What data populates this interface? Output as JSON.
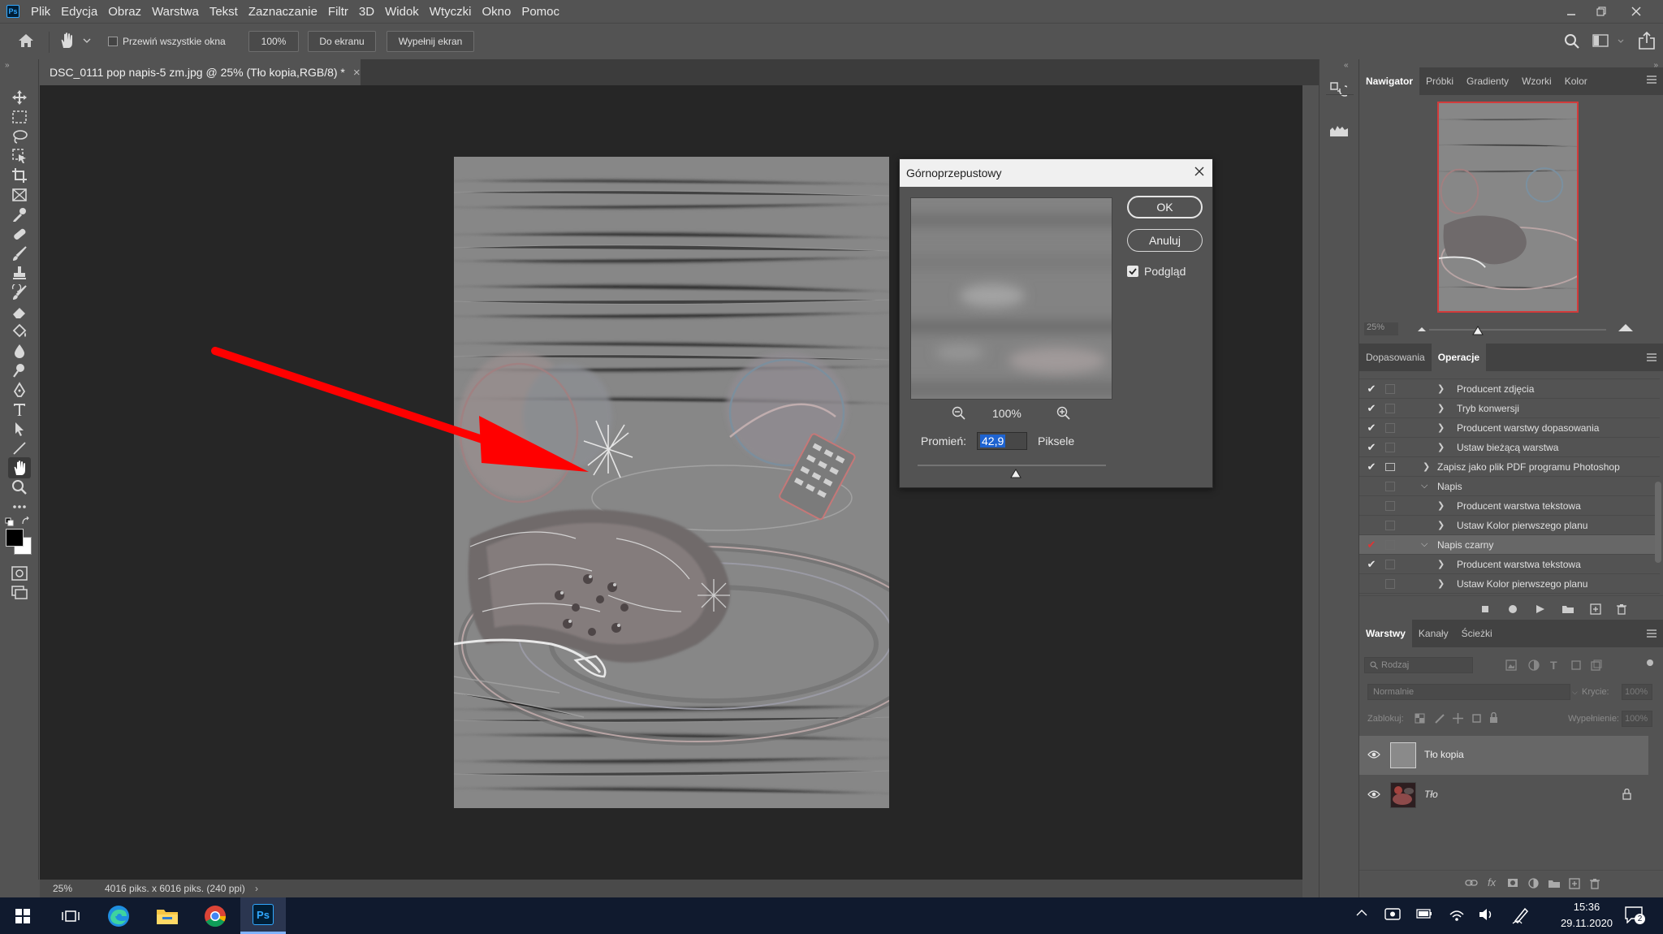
{
  "app": {
    "logo": "Ps"
  },
  "menu": [
    "Plik",
    "Edycja",
    "Obraz",
    "Warstwa",
    "Tekst",
    "Zaznaczanie",
    "Filtr",
    "3D",
    "Widok",
    "Wtyczki",
    "Okno",
    "Pomoc"
  ],
  "options_bar": {
    "scroll_all_label": "Przewiń wszystkie okna",
    "zoom_button": "100%",
    "fit_screen_button": "Do ekranu",
    "fill_screen_button": "Wypełnij ekran"
  },
  "document": {
    "tab_title": "DSC_0111 pop napis-5 zm.jpg @ 25% (Tło kopia,RGB/8) *",
    "close_glyph": "×"
  },
  "status": {
    "zoom": "25%",
    "info": "4016 piks. x 6016 piks. (240 ppi)"
  },
  "dialog": {
    "title": "Górnoprzepustowy",
    "ok": "OK",
    "cancel": "Anuluj",
    "preview_label": "Podgląd",
    "preview_checked": true,
    "zoom": "100%",
    "radius_label": "Promień:",
    "radius_value": "42,9",
    "unit": "Piksele",
    "radius_slider_fraction": 0.52
  },
  "panels": {
    "top_tabs": [
      "Nawigator",
      "Próbki",
      "Gradienty",
      "Wzorki",
      "Kolor"
    ],
    "navigator_zoom": "25%",
    "mid_tabs": [
      "Dopasowania",
      "Operacje"
    ],
    "actions": [
      {
        "check": "✔",
        "label": "Producent zdjęcia",
        "level": 2
      },
      {
        "check": "✔",
        "label": "Tryb konwersji",
        "level": 2
      },
      {
        "check": "✔",
        "label": "Producent warstwy dopasowania",
        "level": 2
      },
      {
        "check": "✔",
        "label": "Ustaw bieżącą warstwa",
        "level": 2
      },
      {
        "check": "✔",
        "label": "Zapisz jako plik PDF programu Photoshop",
        "level": 1
      },
      {
        "check": "",
        "label": "Napis",
        "level": 1
      },
      {
        "check": "",
        "label": "Producent warstwa tekstowa",
        "level": 2
      },
      {
        "check": "",
        "label": "Ustaw Kolor pierwszego planu",
        "level": 2
      },
      {
        "check": "✔",
        "label": "Napis czarny",
        "level": 1
      },
      {
        "check": "✔",
        "label": "Producent warstwa tekstowa",
        "level": 2
      },
      {
        "check": "",
        "label": "Ustaw Kolor pierwszego planu",
        "level": 2
      }
    ],
    "layers_tabs": [
      "Warstwy",
      "Kanały",
      "Ścieżki"
    ],
    "filter_placeholder": "Rodzaj",
    "blend_mode": "Normalnie",
    "opacity_label": "Krycie:",
    "opacity_value": "100%",
    "lock_label": "Zablokuj:",
    "fill_label": "Wypełnienie:",
    "fill_value": "100%",
    "layers": [
      {
        "name": "Tło kopia",
        "selected": true
      },
      {
        "name": "Tło",
        "selected": false
      }
    ]
  },
  "taskbar": {
    "time": "15:36",
    "date": "29.11.2020",
    "notifications": "2"
  },
  "colors": {
    "accent_red": "#ff0000",
    "selection_blue": "#1e63d0",
    "panel_bg": "#535353",
    "canvas_bg": "#262626"
  }
}
